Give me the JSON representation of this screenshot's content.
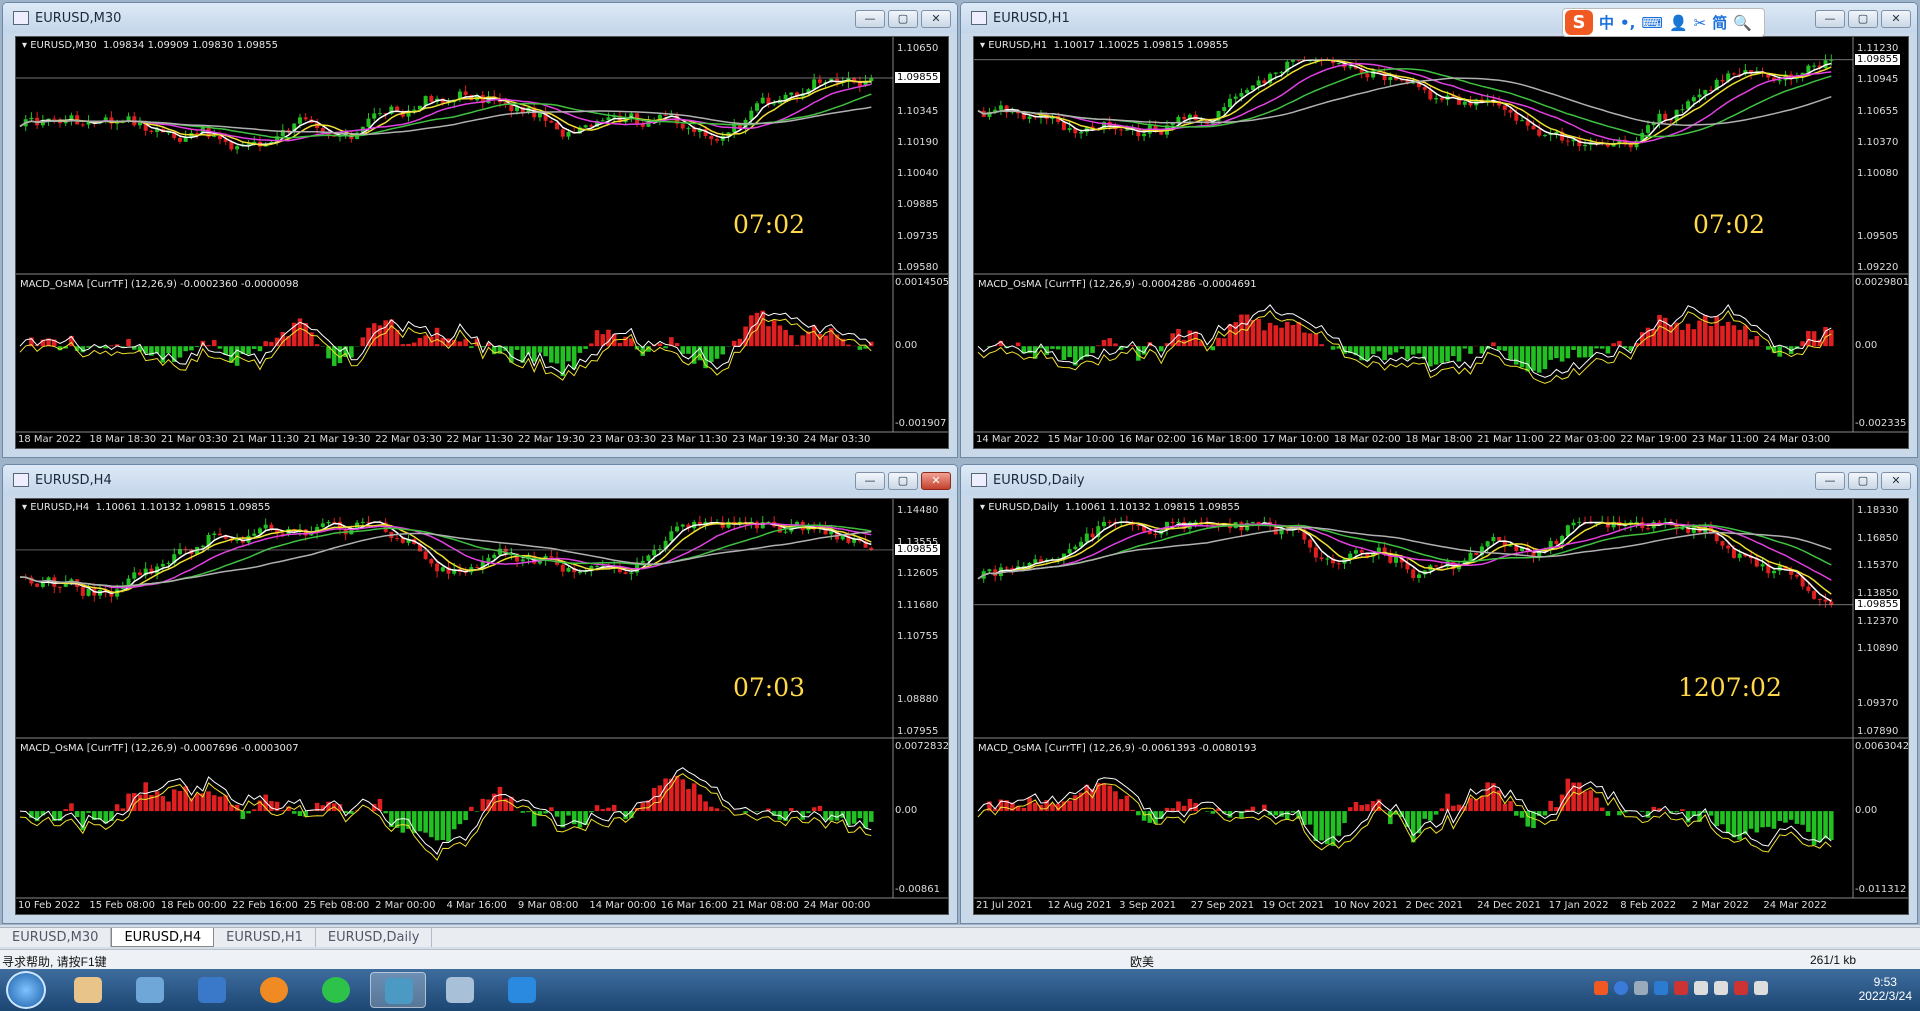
{
  "ime_toolbar": {
    "logo": "S",
    "items": [
      "中",
      "•,",
      "⌨",
      "👤",
      "✂",
      "简",
      "🔍"
    ]
  },
  "windows": [
    {
      "id": "m30",
      "title": "EURUSD,M30",
      "ohlc_label": "EURUSD,M30  1.09834 1.09909 1.09830 1.09855",
      "macd_label": "MACD_OsMA [CurrTF] (12,26,9) -0.0002360 -0.0000098",
      "countdown": "07:02",
      "price_ticks": [
        "1.10650",
        "1.10495",
        "1.10345",
        "1.10190",
        "1.10040",
        "1.09885",
        "1.09735",
        "1.09580"
      ],
      "current_price": "1.09855",
      "macd_ticks": [
        "0.0014505",
        "0.00",
        "-0.001907"
      ],
      "date_ticks": [
        "18 Mar 2022",
        "18 Mar 18:30",
        "21 Mar 03:30",
        "21 Mar 11:30",
        "21 Mar 19:30",
        "22 Mar 03:30",
        "22 Mar 11:30",
        "22 Mar 19:30",
        "23 Mar 03:30",
        "23 Mar 11:30",
        "23 Mar 19:30",
        "24 Mar 03:30"
      ],
      "buttons": [
        "—",
        "▢",
        "✕"
      ]
    },
    {
      "id": "h1",
      "title": "EURUSD,H1",
      "ohlc_label": "EURUSD,H1  1.10017 1.10025 1.09815 1.09855",
      "macd_label": "MACD_OsMA [CurrTF] (12,26,9) -0.0004286 -0.0004691",
      "countdown": "07:02",
      "price_ticks": [
        "1.11230",
        "1.10945",
        "1.10655",
        "1.10370",
        "1.10080",
        "1.09855",
        "1.09505",
        "1.09220"
      ],
      "current_price": "1.09855",
      "macd_ticks": [
        "0.0029801",
        "0.00",
        "-0.002335"
      ],
      "date_ticks": [
        "14 Mar 2022",
        "15 Mar 10:00",
        "16 Mar 02:00",
        "16 Mar 18:00",
        "17 Mar 10:00",
        "18 Mar 02:00",
        "18 Mar 18:00",
        "21 Mar 11:00",
        "22 Mar 03:00",
        "22 Mar 19:00",
        "23 Mar 11:00",
        "24 Mar 03:00"
      ],
      "buttons": [
        "—",
        "▢",
        "✕"
      ]
    },
    {
      "id": "h4",
      "title": "EURUSD,H4",
      "ohlc_label": "EURUSD,H4  1.10061 1.10132 1.09815 1.09855",
      "macd_label": "MACD_OsMA [CurrTF] (12,26,9) -0.0007696 -0.0003007",
      "countdown": "07:03",
      "price_ticks": [
        "1.14480",
        "1.13555",
        "1.12605",
        "1.11680",
        "1.10755",
        "1.09855",
        "1.08880",
        "1.07955"
      ],
      "current_price": "1.09855",
      "macd_ticks": [
        "0.0072832",
        "0.00",
        "-0.00861"
      ],
      "date_ticks": [
        "10 Feb 2022",
        "15 Feb 08:00",
        "18 Feb 00:00",
        "22 Feb 16:00",
        "25 Feb 08:00",
        "2 Mar 00:00",
        "4 Mar 16:00",
        "9 Mar 08:00",
        "14 Mar 00:00",
        "16 Mar 16:00",
        "21 Mar 08:00",
        "24 Mar 00:00"
      ],
      "buttons": [
        "—",
        "▢",
        "✕"
      ]
    },
    {
      "id": "d1",
      "title": "EURUSD,Daily",
      "ohlc_label": "EURUSD,Daily  1.10061 1.10132 1.09815 1.09855",
      "macd_label": "MACD_OsMA [CurrTF] (12,26,9) -0.0061393 -0.0080193",
      "countdown": "1207:02",
      "price_ticks": [
        "1.18330",
        "1.16850",
        "1.15370",
        "1.13850",
        "1.12370",
        "1.10890",
        "1.09855",
        "1.09370",
        "1.07890"
      ],
      "current_price": "1.09855",
      "macd_ticks": [
        "0.0063042",
        "0.00",
        "-0.011312"
      ],
      "date_ticks": [
        "21 Jul 2021",
        "12 Aug 2021",
        "3 Sep 2021",
        "27 Sep 2021",
        "19 Oct 2021",
        "10 Nov 2021",
        "2 Dec 2021",
        "24 Dec 2021",
        "17 Jan 2022",
        "8 Feb 2022",
        "2 Mar 2022",
        "24 Mar 2022"
      ],
      "buttons": [
        "—",
        "▢",
        "✕"
      ]
    }
  ],
  "tabs": [
    "EURUSD,M30",
    "EURUSD,H4",
    "EURUSD,H1",
    "EURUSD,Daily"
  ],
  "active_tab": "EURUSD,H4",
  "status": {
    "help": "寻求帮助, 请按F1键",
    "profile": "欧美",
    "traffic": "261/1 kb"
  },
  "clock": {
    "time": "9:53",
    "date": "2022/3/24"
  },
  "colors": {
    "bull": "#22c022",
    "bear": "#e02020",
    "ma_fast": "#ffffff",
    "ma_yellow": "#f0e030",
    "ma_magenta": "#e040e0",
    "ma_green": "#40c040",
    "ma_gray": "#b0b0b0",
    "countdown": "#ffd94a"
  }
}
